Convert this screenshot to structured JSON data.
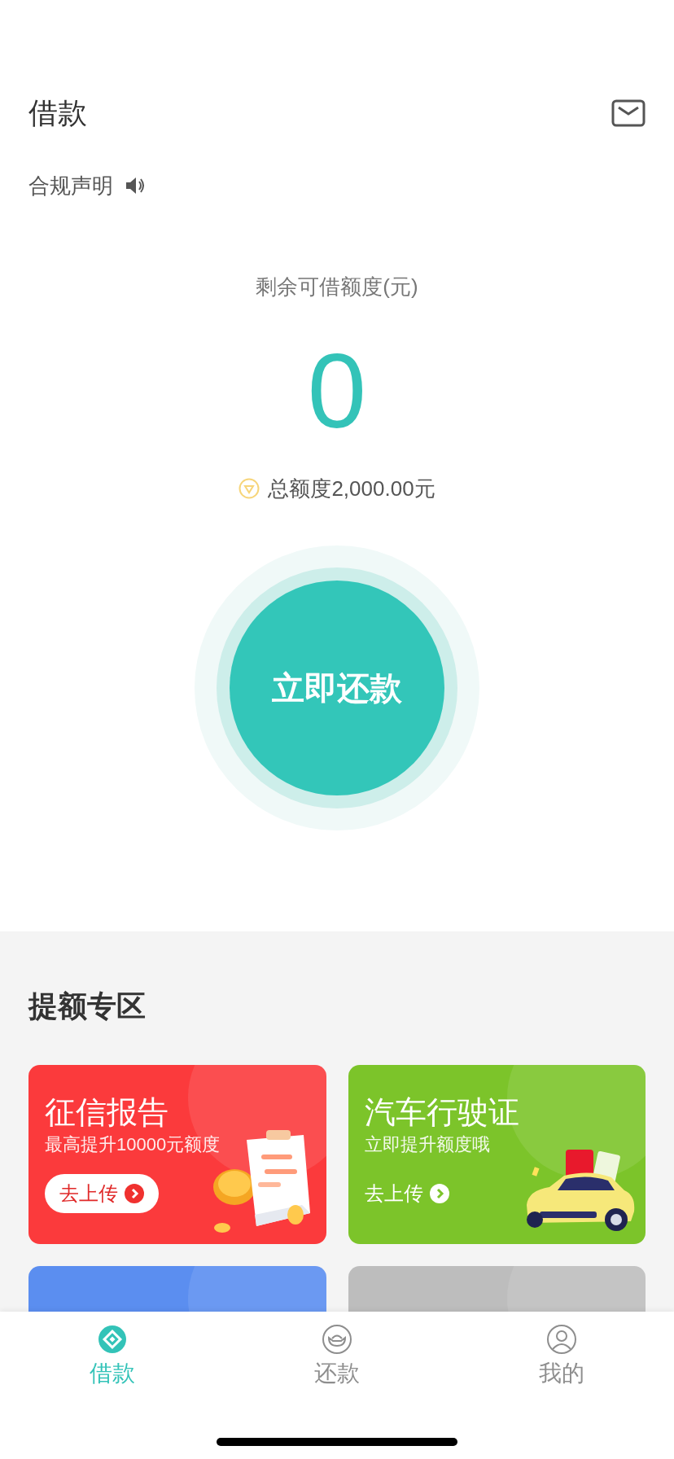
{
  "header": {
    "title": "借款",
    "compliance": "合规声明"
  },
  "credit": {
    "label": "剩余可借额度(元)",
    "amount": "0",
    "total": "总额度2,000.00元"
  },
  "action_button": "立即还款",
  "boost": {
    "title": "提额专区",
    "cards": [
      {
        "title": "征信报告",
        "subtitle": "最高提升10000元额度",
        "action": "去上传",
        "kind": "pill",
        "color": "#fb3a3c"
      },
      {
        "title": "汽车行驶证",
        "subtitle": "立即提升额度哦",
        "action": "去上传",
        "kind": "plain",
        "color": "#7cc42a"
      },
      {
        "color": "#5b8ef0"
      },
      {
        "color": "#bdbdbd"
      }
    ]
  },
  "tab_bar": [
    {
      "label": "借款",
      "selected": true
    },
    {
      "label": "还款",
      "selected": false
    },
    {
      "label": "我的",
      "selected": false
    }
  ]
}
